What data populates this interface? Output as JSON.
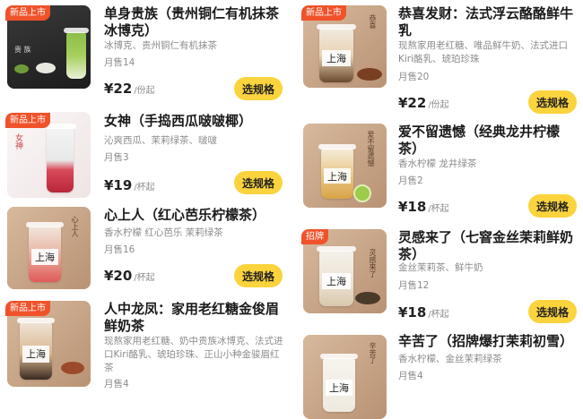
{
  "price_unit": "/份起",
  "cup_unit": "/杯起",
  "action_label": "选规格",
  "left_column": [
    {
      "badge": "新品上市",
      "title": "单身贵族（贵州铜仁有机抹茶冰博克）",
      "desc": "冰博克、贵州铜仁有机抹茶",
      "sales": "月售14",
      "price": "¥22",
      "unit": "/份起",
      "thumb_text": "贵 族",
      "thumb_color": "#2f2f2f"
    },
    {
      "badge": "新品上市",
      "title": "女神（手捣西瓜啵啵椰）",
      "desc": "沁爽西瓜、茉莉绿茶、啵啵",
      "sales": "月售3",
      "price": "¥19",
      "unit": "/杯起",
      "thumb_text": "女神",
      "thumb_color": "#f3ecec"
    },
    {
      "badge": "",
      "title": "心上人（红心芭乐柠檬茶）",
      "desc": "香水柠檬 红心芭乐 茉莉绿茶",
      "sales": "月售16",
      "price": "¥20",
      "unit": "/杯起",
      "thumb_text": "上海",
      "thumb_color": "#c9a98a"
    },
    {
      "badge": "新品上市",
      "title": "人中龙凤：家用老红糖金俊眉鲜奶茶",
      "desc": "现熬家用老红糖、奶中贵族冰博克、法式进口Kiri酪乳、琥珀珍珠、正山小种金骏眉红茶",
      "sales": "月售4",
      "price": "",
      "unit": "",
      "thumb_text": "上海",
      "thumb_color": "#c9a98a"
    }
  ],
  "right_column": [
    {
      "badge": "新品上市",
      "title": "恭喜发财：法式浮云酪酪鲜牛乳",
      "desc": "现熬家用老红糖、唯品鲜牛奶、法式进口Kiri酪乳、琥珀珍珠",
      "sales": "月售20",
      "price": "¥22",
      "unit": "/份起",
      "thumb_text": "上海",
      "thumb_color": "#c9a98a"
    },
    {
      "badge": "",
      "title": "爱不留遗憾（经典龙井柠檬茶）",
      "desc": "香水柠檬 龙井绿茶",
      "sales": "月售2",
      "price": "¥18",
      "unit": "/杯起",
      "thumb_text": "上海",
      "thumb_color": "#c9a98a"
    },
    {
      "badge": "招牌",
      "title": "灵感来了（七窨金丝茉莉鲜奶茶）",
      "desc": "金丝茉莉茶、鲜牛奶",
      "sales": "月售12",
      "price": "¥18",
      "unit": "/杯起",
      "thumb_text": "上海",
      "thumb_color": "#c9a98a"
    },
    {
      "badge": "",
      "title": "辛苦了（招牌爆打茉莉初雪）",
      "desc": "香水柠檬、金丝茉莉绿茶",
      "sales": "月售4",
      "price": "",
      "unit": "",
      "thumb_text": "上海",
      "thumb_color": "#c9a98a"
    }
  ]
}
